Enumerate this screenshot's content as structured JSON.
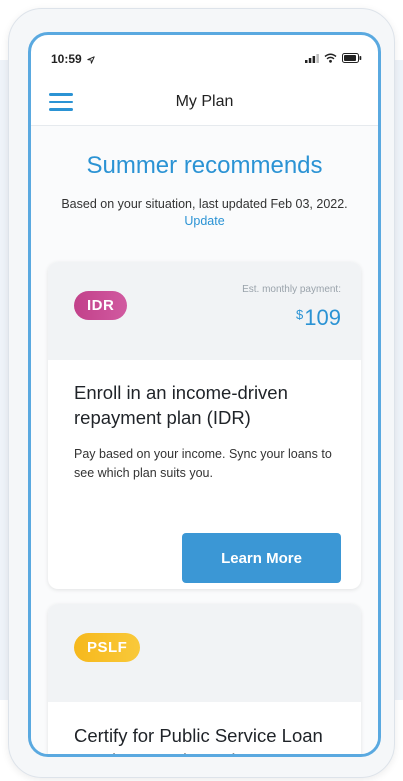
{
  "status_bar": {
    "time": "10:59",
    "location_icon": "location-arrow-icon",
    "signal_icon": "cellular-signal-icon",
    "wifi_icon": "wifi-icon",
    "battery_icon": "battery-icon"
  },
  "nav": {
    "menu_icon": "hamburger-menu-icon",
    "title": "My Plan"
  },
  "recommendations": {
    "heading": "Summer recommends",
    "subtitle_prefix": "Based on your situation, last updated Feb 03, 2022.",
    "update_link": "Update"
  },
  "cards": [
    {
      "badge": "IDR",
      "est_label": "Est. monthly payment:",
      "currency": "$",
      "amount": "109",
      "title": "Enroll in an income-driven repayment plan (IDR)",
      "description": "Pay based on your income. Sync your loans to see which plan suits you.",
      "button_label": "Learn More"
    },
    {
      "badge": "PSLF",
      "title": "Certify for Public Service Loan Forgiveness (PSLF)"
    }
  ],
  "colors": {
    "accent": "#2b93d4",
    "button": "#3b97d5",
    "idr_badge": "#c2418a",
    "pslf_badge": "#f6b81c",
    "frame_border": "#5aa9e0"
  }
}
